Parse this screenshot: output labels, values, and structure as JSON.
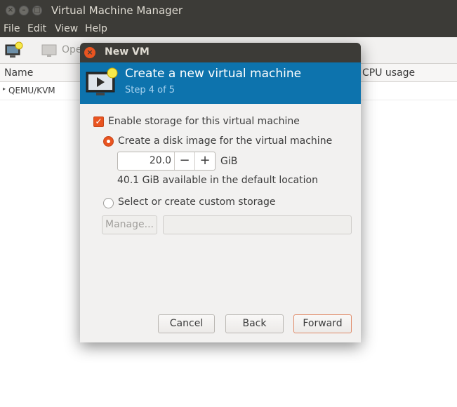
{
  "main_window": {
    "title": "Virtual Machine Manager",
    "menu": [
      "File",
      "Edit",
      "View",
      "Help"
    ],
    "toolbar": {
      "open_label": "Ope"
    },
    "columns": {
      "name": "Name",
      "cpu": "CPU usage"
    },
    "connection": "QEMU/KVM"
  },
  "dialog": {
    "title": "New VM",
    "header": {
      "title": "Create a new virtual machine",
      "step": "Step 4 of 5"
    },
    "enable_storage": {
      "label": "Enable storage for this virtual machine",
      "checked": true
    },
    "create_disk": {
      "label": "Create a disk image for the virtual machine",
      "selected": true
    },
    "disk_size": {
      "value": "20.0",
      "minus": "−",
      "plus": "+",
      "unit": "GiB"
    },
    "available_text": "40.1 GiB available in the default location",
    "custom_storage": {
      "label": "Select or create custom storage",
      "selected": false
    },
    "manage_button": "Manage...",
    "storage_path": "",
    "buttons": {
      "cancel": "Cancel",
      "back": "Back",
      "forward": "Forward"
    }
  },
  "colors": {
    "accent": "#e95420",
    "header_blue": "#0d73ad",
    "titlebar": "#3c3b37"
  }
}
